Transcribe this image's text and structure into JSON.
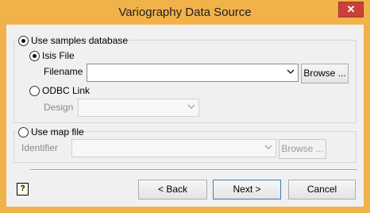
{
  "window": {
    "title": "Variography Data Source",
    "close_glyph": "✕"
  },
  "source": {
    "samples_db_label": "Use samples database",
    "isis_label": "Isis File",
    "filename_label": "Filename",
    "filename_value": "",
    "browse_label": "Browse ...",
    "odbc_label": "ODBC Link",
    "design_label": "Design",
    "design_value": ""
  },
  "mapfile": {
    "label": "Use map file",
    "identifier_label": "Identifier",
    "identifier_value": "",
    "browse_label": "Browse ..."
  },
  "footer": {
    "help_glyph": "?",
    "back_label": "< Back",
    "next_label": "Next >",
    "cancel_label": "Cancel"
  },
  "selection": {
    "use_samples_database": true,
    "isis_file": true,
    "odbc_link": false,
    "use_map_file": false
  },
  "colors": {
    "title_bar": "#f2b24a",
    "close_button": "#c9413a",
    "dialog_bg": "#f0f0f0"
  },
  "icons": {
    "close": "close-icon",
    "help": "help-icon",
    "dropdown": "chevron-down-icon"
  }
}
